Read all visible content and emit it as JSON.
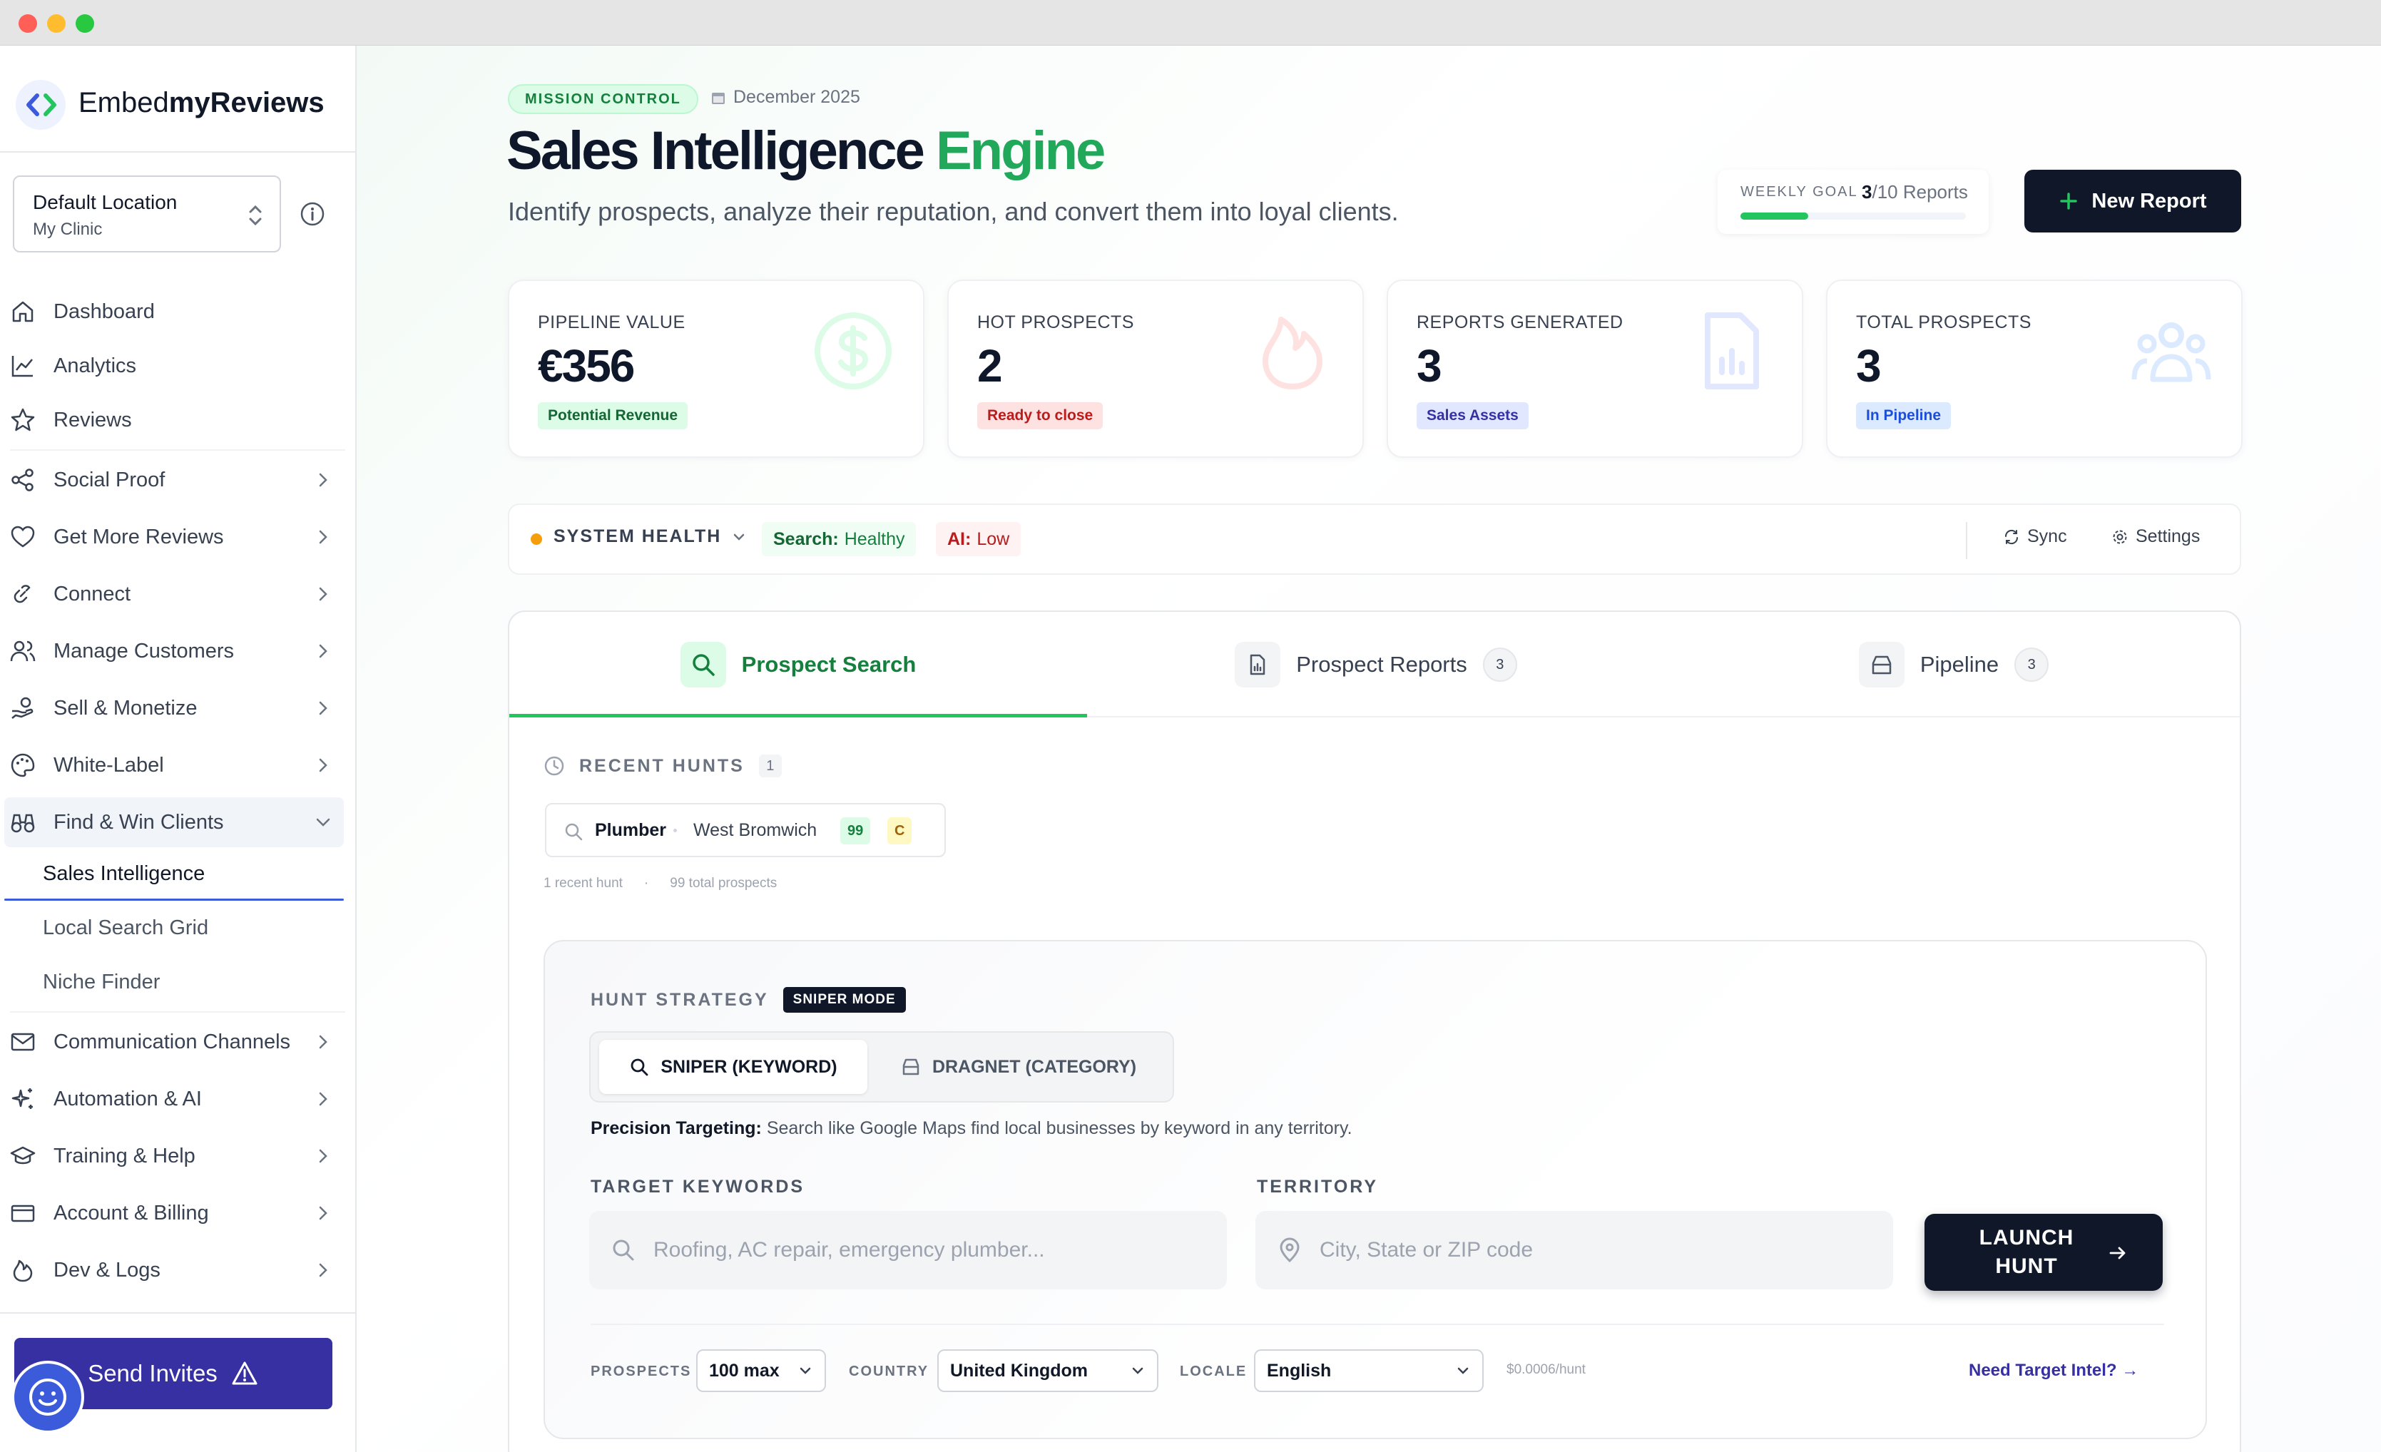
{
  "brand": {
    "name_part1": "Embed",
    "name_part2": "myReviews"
  },
  "location": {
    "title": "Default Location",
    "subtitle": "My Clinic"
  },
  "nav": {
    "dashboard": "Dashboard",
    "analytics": "Analytics",
    "reviews": "Reviews",
    "social_proof": "Social Proof",
    "get_more_reviews": "Get More Reviews",
    "connect": "Connect",
    "manage_customers": "Manage Customers",
    "sell_monetize": "Sell & Monetize",
    "white_label": "White-Label",
    "find_win_clients": "Find & Win Clients",
    "sub_sales_intelligence": "Sales Intelligence",
    "sub_local_search_grid": "Local Search Grid",
    "sub_niche_finder": "Niche Finder",
    "communication_channels": "Communication Channels",
    "automation_ai": "Automation & AI",
    "training_help": "Training & Help",
    "account_billing": "Account & Billing",
    "dev_logs": "Dev & Logs"
  },
  "send_invites": "Send Invites",
  "header": {
    "badge": "MISSION CONTROL",
    "date": "December 2025",
    "title_main": "Sales Intelligence",
    "title_accent": "Engine",
    "subtitle": "Identify prospects, analyze their reputation, and convert them into loyal clients."
  },
  "weekly_goal": {
    "label": "WEEKLY GOAL",
    "current": "3",
    "total": "/10 Reports",
    "progress": 0.3
  },
  "new_report_label": "New Report",
  "kpis": [
    {
      "label": "PIPELINE VALUE",
      "value": "€356",
      "pill": "Potential Revenue"
    },
    {
      "label": "HOT PROSPECTS",
      "value": "2",
      "pill": "Ready to close"
    },
    {
      "label": "REPORTS GENERATED",
      "value": "3",
      "pill": "Sales Assets"
    },
    {
      "label": "TOTAL PROSPECTS",
      "value": "3",
      "pill": "In Pipeline"
    }
  ],
  "health": {
    "label": "SYSTEM HEALTH",
    "search_key": "Search:",
    "search_val": "Healthy",
    "ai_key": "AI:",
    "ai_val": "Low",
    "sync": "Sync",
    "settings": "Settings"
  },
  "tabs": [
    {
      "label": "Prospect Search",
      "count": ""
    },
    {
      "label": "Prospect Reports",
      "count": "3"
    },
    {
      "label": "Pipeline",
      "count": "3"
    }
  ],
  "recent": {
    "label": "RECENT HUNTS",
    "count": "1",
    "hunt_keyword": "Plumber",
    "hunt_location": "West Bromwich",
    "hunt_score": "99",
    "hunt_grade": "C",
    "summary1": "1 recent hunt",
    "summary2": "99 total prospects"
  },
  "strategy": {
    "label": "HUNT STRATEGY",
    "mode_badge": "SNIPER MODE",
    "opt_sniper": "SNIPER (KEYWORD)",
    "opt_dragnet": "DRAGNET (CATEGORY)",
    "desc_bold": "Precision Targeting:",
    "desc": "Search like Google Maps find local businesses by keyword in any territory.",
    "keywords_label": "TARGET KEYWORDS",
    "keywords_placeholder": "Roofing, AC repair, emergency plumber...",
    "territory_label": "TERRITORY",
    "territory_placeholder": "City, State or ZIP code",
    "launch_line1": "LAUNCH",
    "launch_line2": "HUNT",
    "prospects_label": "PROSPECTS",
    "prospects_val": "100 max",
    "country_label": "COUNTRY",
    "country_val": "United Kingdom",
    "locale_label": "LOCALE",
    "locale_val": "English",
    "cost": "$0.0006/hunt",
    "intel_link": "Need Target Intel? →"
  }
}
